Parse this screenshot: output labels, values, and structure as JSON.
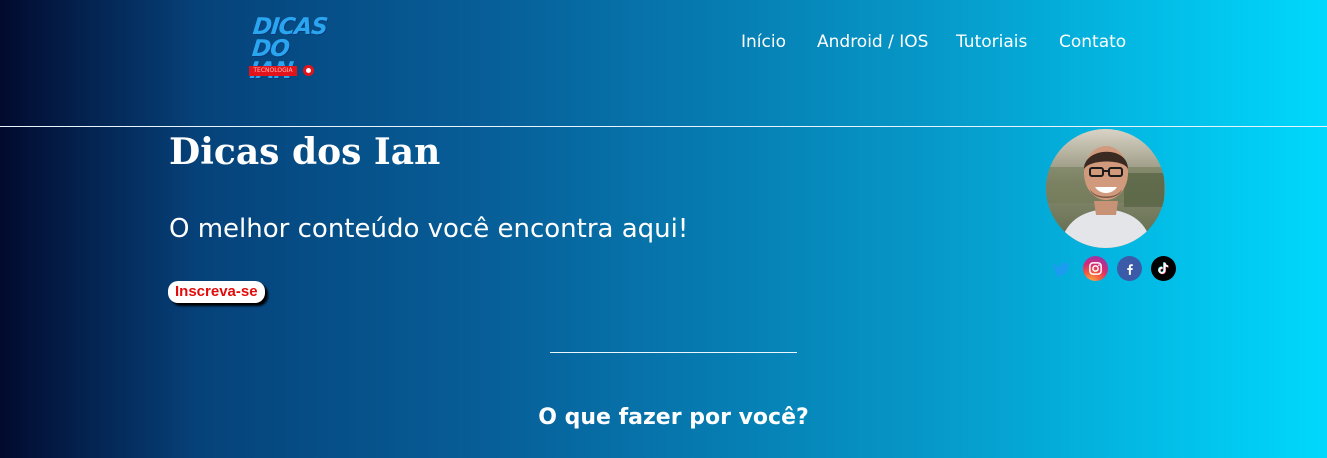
{
  "brand": {
    "logo_line1": "DICAS",
    "logo_line2": "DO IAN",
    "logo_tagline": "TECNOLOGIA"
  },
  "nav": {
    "items": [
      {
        "label": "Início"
      },
      {
        "label": "Android / IOS"
      },
      {
        "label": "Tutoriais"
      },
      {
        "label": "Contato"
      }
    ]
  },
  "hero": {
    "title": "Dicas dos Ian",
    "subtitle": "O melhor conteúdo você encontra aqui!",
    "cta_label": "Inscreva-se"
  },
  "profile": {
    "avatar": "profile-photo",
    "socials": [
      {
        "icon": "twitter-icon",
        "color": "#1d9bf0"
      },
      {
        "icon": "instagram-icon",
        "color": "#d62976"
      },
      {
        "icon": "facebook-icon",
        "color": "#3b5ba8"
      },
      {
        "icon": "tiktok-icon",
        "color": "#000000"
      }
    ]
  },
  "section": {
    "question": "O que fazer por você?"
  },
  "colors": {
    "gradient_start": "#020a2e",
    "gradient_end": "#00d8fd",
    "cta_text": "#e30b0b",
    "logo_blue": "#2aa5f0",
    "logo_red": "#e3131b"
  }
}
